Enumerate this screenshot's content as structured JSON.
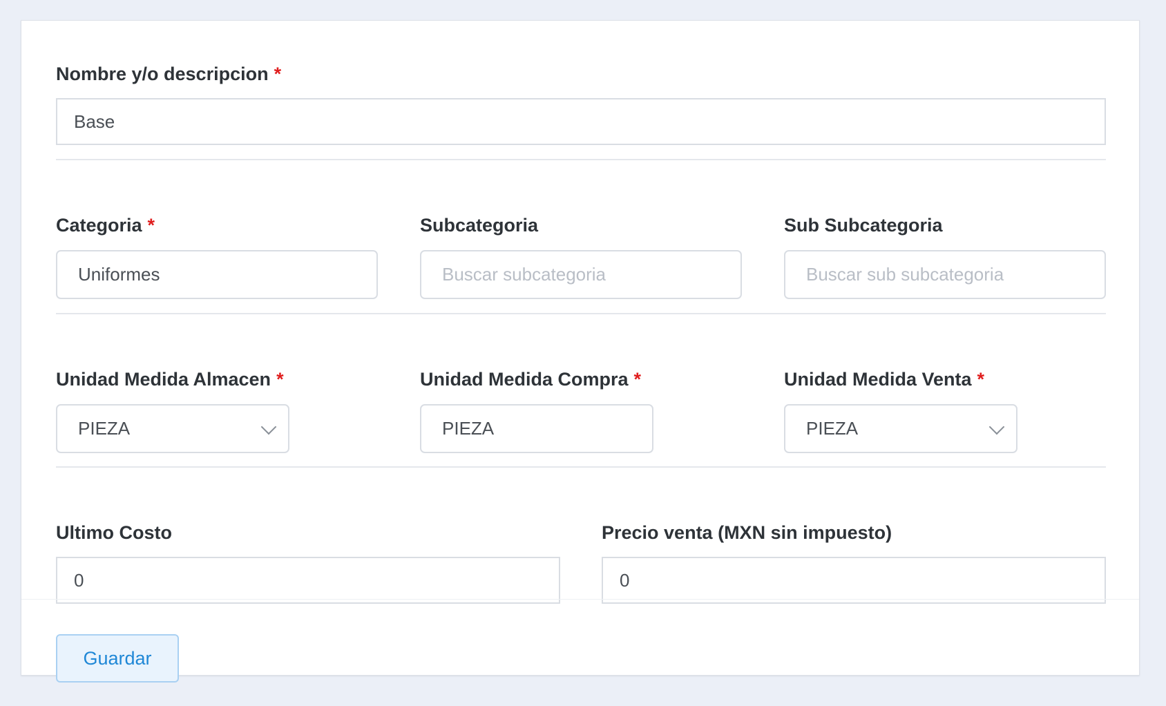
{
  "form": {
    "nombre": {
      "label": "Nombre y/o descripcion",
      "required_mark": "*",
      "value": "Base"
    },
    "categoria": {
      "label": "Categoria",
      "required_mark": "*",
      "value": "Uniformes"
    },
    "subcategoria": {
      "label": "Subcategoria",
      "value": "",
      "placeholder": "Buscar subcategoria"
    },
    "sub_subcategoria": {
      "label": "Sub Subcategoria",
      "value": "",
      "placeholder": "Buscar sub subcategoria"
    },
    "unidad_almacen": {
      "label": "Unidad Medida Almacen",
      "required_mark": "*",
      "value": "PIEZA"
    },
    "unidad_compra": {
      "label": "Unidad Medida Compra",
      "required_mark": "*",
      "value": "PIEZA"
    },
    "unidad_venta": {
      "label": "Unidad Medida Venta",
      "required_mark": "*",
      "value": "PIEZA"
    },
    "ultimo_costo": {
      "label": "Ultimo Costo",
      "value": "0"
    },
    "precio_venta": {
      "label": "Precio venta (MXN sin impuesto)",
      "value": "0"
    }
  },
  "footer": {
    "save_label": "Guardar"
  },
  "colors": {
    "accent": "#1f87d6",
    "required": "#e01e1e",
    "background": "#ebeff7"
  },
  "icons": {
    "select_arrow": "chevron-down-icon"
  }
}
